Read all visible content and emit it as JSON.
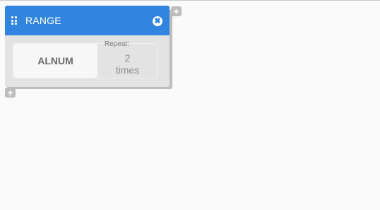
{
  "block": {
    "title": "RANGE",
    "value": "ALNUM",
    "repeat_label": "Repeat:",
    "repeat_count": "2",
    "repeat_unit": "times",
    "close_glyph": "✖",
    "header_color": "#3285df"
  },
  "controls": {
    "add_top_glyph": "+",
    "add_bottom_glyph": "+"
  },
  "icons": {
    "drag_handle": "grip-icon",
    "close": "close-icon",
    "add": "plus-icon"
  }
}
